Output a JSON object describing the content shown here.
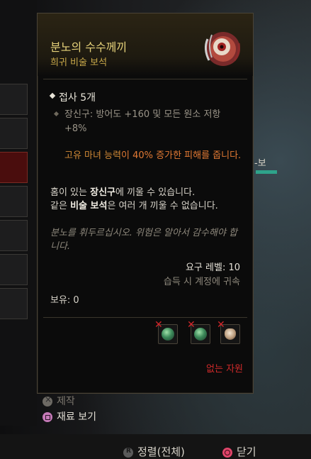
{
  "item": {
    "name": "분노의 수수께끼",
    "rarity": "희귀 비술 보석",
    "icon": "gem-eye-icon"
  },
  "affix": {
    "title": "접사 5개",
    "line": "장신구: 방어도 +160 및 모든 원소 저항 +8%"
  },
  "legendary": {
    "prefix": "고유 마녀 능력",
    "highlight": "이 40% 증가한 피해를 줍니다."
  },
  "description": {
    "p1_a": "홈이 있는 ",
    "p1_b": "장신구",
    "p1_c": "에 끼울 수 있습니다.",
    "p2_a": "같은 ",
    "p2_b": "비술 보석",
    "p2_c": "은 여러 개 끼울 수 없습니다."
  },
  "flavor": "분노를 휘두르십시오. 위험은 알아서 감수해야 합니다.",
  "requirements": {
    "level": "요구 레벨: 10",
    "bound": "습득 시 계정에 귀속"
  },
  "owned": "보유: 0",
  "materials": [
    {
      "icon": "green-gem-icon",
      "missing": true
    },
    {
      "icon": "green-gem-icon",
      "missing": true
    },
    {
      "icon": "bone-trophy-icon",
      "missing": true
    }
  ],
  "missing_resources": "없는 자원",
  "prompts": {
    "craft": "제작",
    "view_materials": "재료 보기",
    "sort": "정렬(전체)",
    "close": "닫기"
  },
  "background": {
    "right_label": "-보"
  },
  "colors": {
    "item_name": "#e6d27a",
    "rarity": "#c9a94a",
    "legendary": "#e37a34",
    "missing": "#d12a2a",
    "accent_bar": "#2ea38a"
  }
}
